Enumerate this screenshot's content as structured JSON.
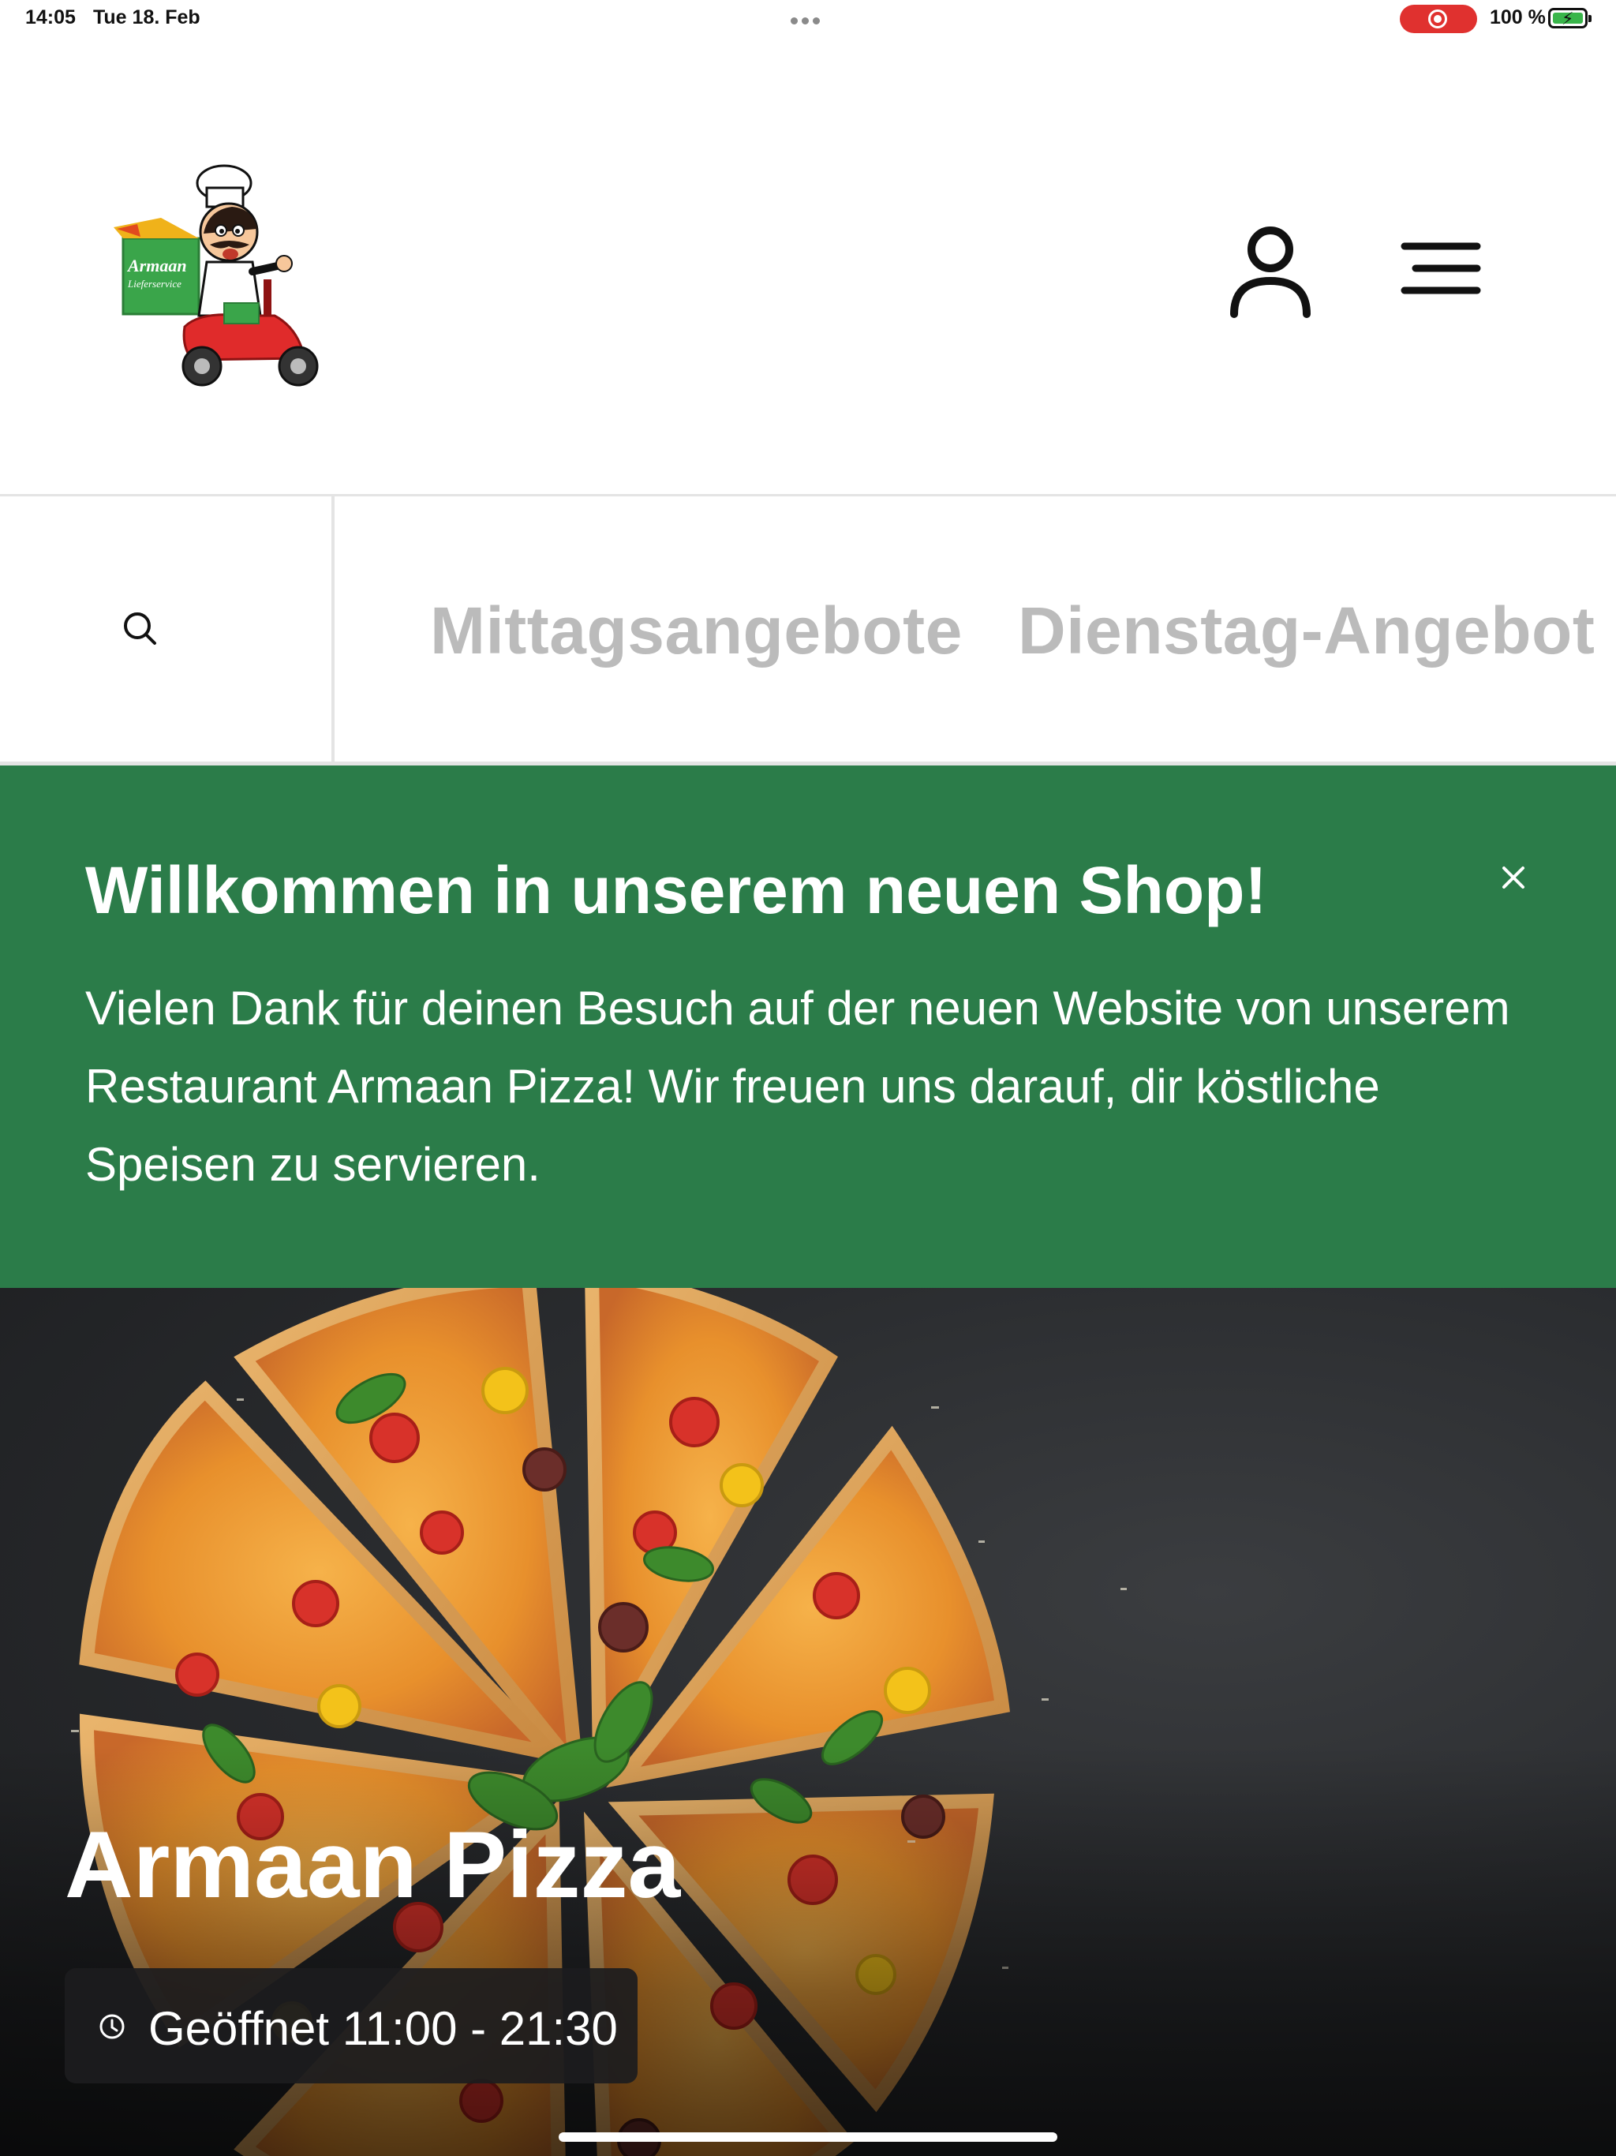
{
  "status_bar": {
    "time": "14:05",
    "date": "Tue 18. Feb",
    "battery": "100 %",
    "battery_state": "charging",
    "recording_indicator_color": "#e0312f"
  },
  "header": {
    "logo": {
      "brand_lines": [
        "Armaan",
        "Lieferservice"
      ],
      "icon": "chef-on-scooter-logo"
    },
    "account_icon": "user-icon",
    "menu_icon": "hamburger-menu-icon"
  },
  "category_bar": {
    "search_icon": "search-icon",
    "tabs": [
      {
        "label": "Mittagsangebote"
      },
      {
        "label": "Dienstag-Angebot"
      }
    ]
  },
  "banner": {
    "title": "Willkommen in unserem neuen Shop!",
    "text": "Vielen Dank für deinen Besuch auf der neuen Website von unserem Restaurant Armaan Pizza! Wir freuen uns darauf, dir köstliche Speisen zu servieren.",
    "close_icon": "close-icon",
    "background_color": "#2b7c49"
  },
  "hero": {
    "title": "Armaan Pizza",
    "hours": "Geöffnet 11:00 - 21:30",
    "clock_icon": "clock-icon",
    "image": "sliced-pizza-photo"
  },
  "colors": {
    "accent_green": "#2b7c49",
    "tab_text": "#bbbbbb",
    "divider": "#e4e4e4"
  }
}
